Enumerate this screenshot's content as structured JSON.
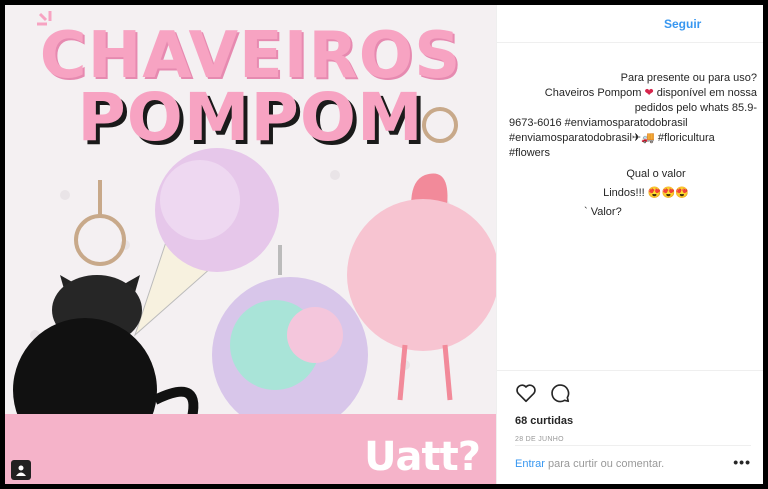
{
  "image": {
    "title_line1": "CHAVEIROS",
    "title_line2": "POMPOM",
    "brand": "Uatt?"
  },
  "header": {
    "follow_label": "Seguir"
  },
  "caption": {
    "line1": "Para presente ou para uso?",
    "line2_pre": "Chaveiros Pompom",
    "line2_post": "disponível em nossa",
    "line3": "pedidos pelo whats 85.9-",
    "line4_pre": "9673-6016",
    "hashtag1": "#enviamosparatodobrasil",
    "hashtag2": "#enviamosparatodobrasil",
    "hashtag3": "#floricultura",
    "hashtag4": "#flowers"
  },
  "comments": [
    {
      "text": "Qual o valor"
    },
    {
      "text": "Lindos!!! 😍😍😍"
    },
    {
      "text": "` Valor?"
    }
  ],
  "actions": {
    "likes": "68 curtidas",
    "date": "28 DE JUNHO"
  },
  "comment_input": {
    "action": "Entrar",
    "hint": "para curtir ou comentar.",
    "more": "•••"
  },
  "colors": {
    "accent": "#3897f0",
    "pink": "#f7a3c2",
    "hashtag": "#003569"
  },
  "icons": [
    "heart-icon",
    "comment-icon",
    "more-icon",
    "user-tag-icon"
  ]
}
